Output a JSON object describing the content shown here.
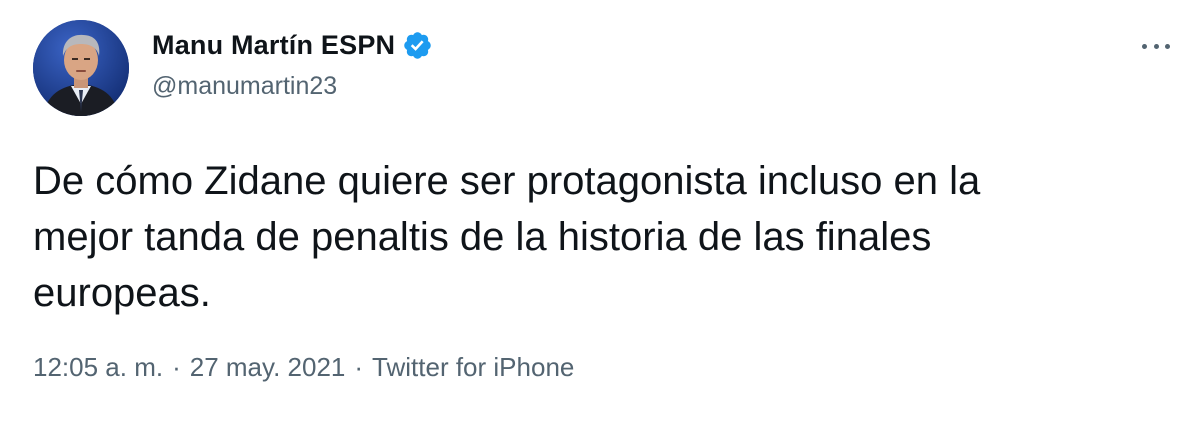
{
  "tweet": {
    "author": {
      "display_name": "Manu Martín ESPN",
      "handle": "@manumartin23",
      "verified": true,
      "avatar_icon": "profile-photo"
    },
    "text": "De cómo Zidane quiere ser protagonista incluso en la\nmejor tanda de penaltis de la historia de las finales\neuropeas.",
    "time": "12:05 a. m.",
    "date": "27 may. 2021",
    "source": "Twitter for iPhone",
    "separator": "·",
    "more_icon": "more-horizontal-icon"
  },
  "colors": {
    "text_primary": "#0f1419",
    "text_secondary": "#536471",
    "verified_blue": "#1d9bf0",
    "background": "#ffffff"
  }
}
